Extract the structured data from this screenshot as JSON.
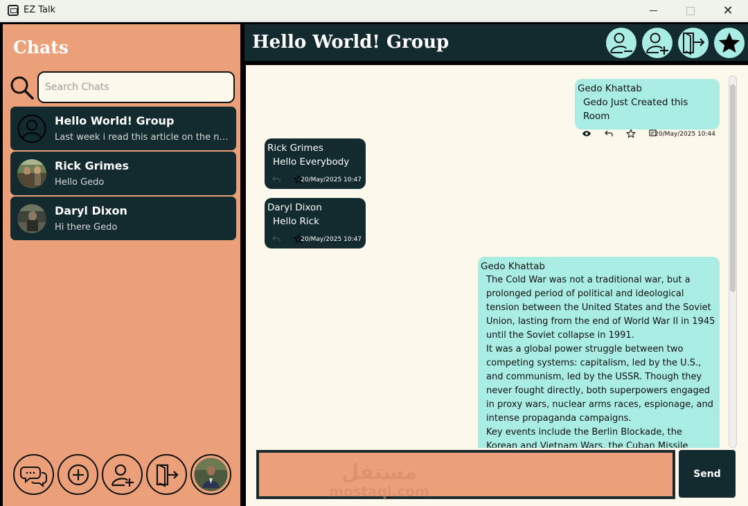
{
  "window": {
    "title": "EZ Talk",
    "close_glyph": "✕"
  },
  "sidebar": {
    "title": "Chats",
    "search": {
      "placeholder": "Search Chats"
    },
    "chats": [
      {
        "name": "Hello World! Group",
        "preview": "Last week i read this article on the new...",
        "avatar": "group-avatar-icon"
      },
      {
        "name": "Rick Grimes",
        "preview": "Hello Gedo",
        "avatar": "photo"
      },
      {
        "name": "Daryl Dixon",
        "preview": "Hi there Gedo",
        "avatar": "photo"
      }
    ],
    "bottom_buttons": [
      "chats-icon",
      "create-room-icon",
      "add-contact-icon",
      "logout-icon",
      "profile-avatar"
    ]
  },
  "chat": {
    "title": "Hello World! Group",
    "header_buttons": [
      "remove-member-icon",
      "add-member-icon",
      "leave-room-icon",
      "star-icon"
    ],
    "messages": [
      {
        "sender": "Gedo Khattab",
        "text": "Gedo Just Created this Room",
        "time": "20/May/2025 10:44",
        "mine": true
      },
      {
        "sender": "Rick Grimes",
        "text": "Hello Everybody",
        "time": "20/May/2025 10:47",
        "mine": false
      },
      {
        "sender": "Daryl Dixon",
        "text": "Hello Rick",
        "time": "20/May/2025 10:47",
        "mine": false
      },
      {
        "sender": "Gedo Khattab",
        "mine": true,
        "paragraphs": [
          "The Cold War was not a traditional war, but a prolonged period of political and ideological tension between the United States and the Soviet Union, lasting from the end of World War II in 1945 until the Soviet collapse in 1991.",
          "It was a global power struggle between two competing systems: capitalism, led by the U.S., and communism, led by the USSR. Though they never fought directly, both superpowers engaged in proxy wars, nuclear arms races, espionage, and intense propaganda campaigns.",
          "Key events include the Berlin Blockade, the Korean and Vietnam Wars, the Cuban Missile Crisis, and the"
        ]
      }
    ],
    "composer": {
      "send_label": "Send"
    }
  },
  "watermark": {
    "arabic": "مستقل",
    "latin": "mostaql.com"
  },
  "colors": {
    "sidebar": "#eba07a",
    "dark": "#132b2f",
    "mint": "#a8ece3",
    "cream": "#fcf8eb"
  }
}
